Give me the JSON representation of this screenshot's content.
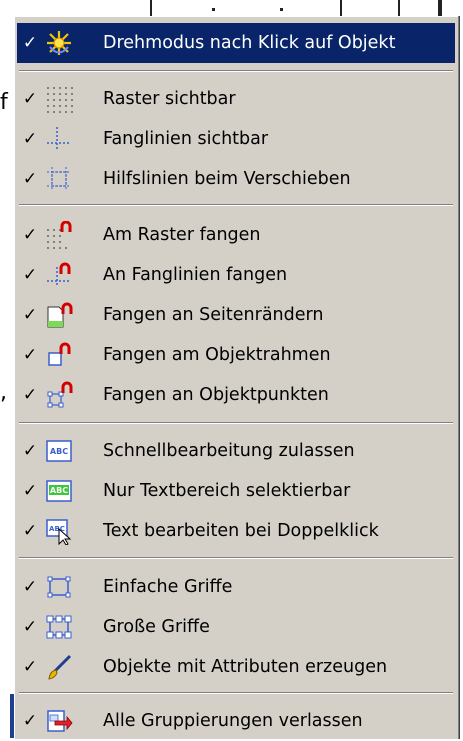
{
  "background": {
    "chars": [
      "f",
      ","
    ]
  },
  "menu": {
    "check_glyph": "✓",
    "items": [
      {
        "label": "Drehmodus nach Klick auf Objekt",
        "icon": "rotate-sparkle-icon",
        "checked": true
      },
      {
        "label": "Raster sichtbar",
        "icon": "dot-grid-icon",
        "checked": true
      },
      {
        "label": "Fanglinien sichtbar",
        "icon": "snap-lines-icon",
        "checked": true
      },
      {
        "label": "Hilfslinien beim Verschieben",
        "icon": "helper-lines-icon",
        "checked": true
      },
      {
        "label": "Am Raster fangen",
        "icon": "snap-to-grid-icon",
        "checked": true
      },
      {
        "label": "An Fanglinien fangen",
        "icon": "snap-to-lines-icon",
        "checked": true
      },
      {
        "label": "Fangen an Seitenrändern",
        "icon": "snap-page-margins-icon",
        "checked": true
      },
      {
        "label": "Fangen am Objektrahmen",
        "icon": "snap-object-frame-icon",
        "checked": true
      },
      {
        "label": "Fangen an Objektpunkten",
        "icon": "snap-object-points-icon",
        "checked": true
      },
      {
        "label": "Schnellbearbeitung zulassen",
        "icon": "quick-edit-abc-icon",
        "checked": true
      },
      {
        "label": "Nur Textbereich selektierbar",
        "icon": "text-area-abc-icon",
        "checked": true
      },
      {
        "label": "Text bearbeiten bei Doppelklick",
        "icon": "edit-text-cursor-icon",
        "checked": true
      },
      {
        "label": "Einfache Griffe",
        "icon": "simple-handles-icon",
        "checked": true
      },
      {
        "label": "Große Griffe",
        "icon": "large-handles-icon",
        "checked": true
      },
      {
        "label": "Objekte mit Attributen erzeugen",
        "icon": "brush-attributes-icon",
        "checked": true
      },
      {
        "label": "Alle Gruppierungen verlassen",
        "icon": "exit-groups-icon",
        "checked": true
      }
    ]
  },
  "colors": {
    "menu_bg": "#d4d0c8",
    "highlight": "#0a246a"
  }
}
